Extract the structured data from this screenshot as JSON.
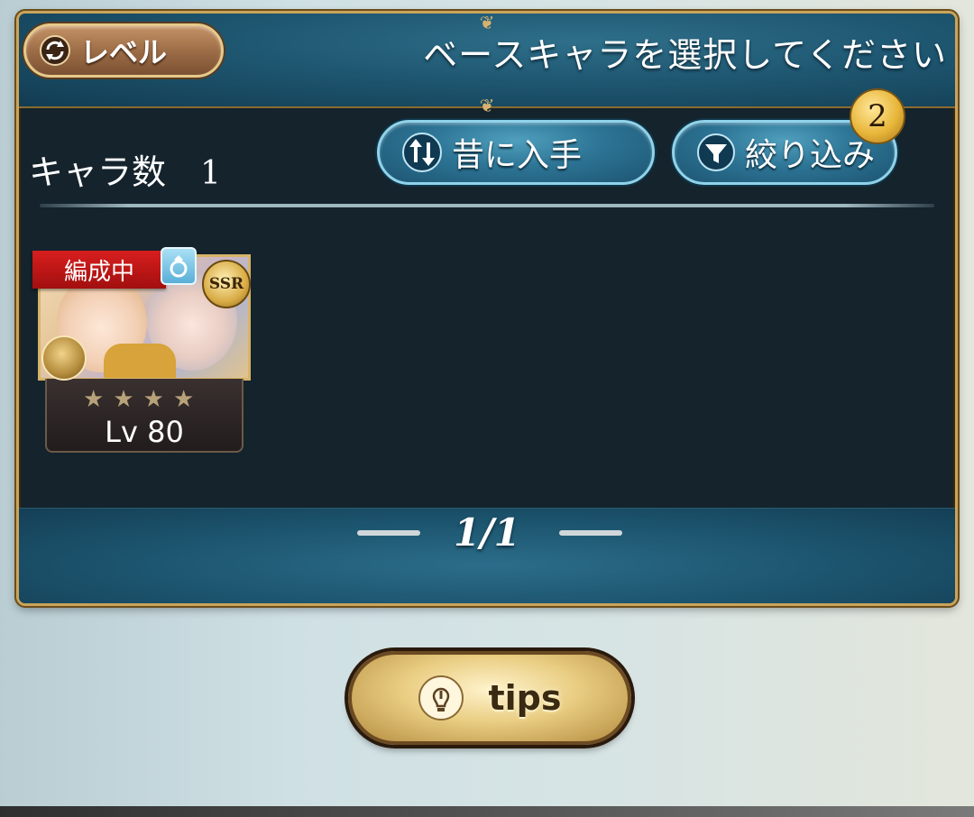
{
  "header": {
    "level_button_label": "レベル",
    "title": "ベースキャラを選択してください"
  },
  "toolbar": {
    "chara_count_label": "キャラ数",
    "chara_count_value": "1",
    "sort_label": "昔に入手",
    "filter_label": "絞り込み",
    "filter_count": "2"
  },
  "characters": [
    {
      "formation_label": "編成中",
      "rarity": "SSR",
      "stars": 4,
      "level": "Lv 80"
    }
  ],
  "pagination": {
    "text": "1/1"
  },
  "tips_button_label": "tips",
  "colors": {
    "panel_bg": "#14232c",
    "header_blue": "#1e5670",
    "gold_border": "#c9a45a",
    "formation_red": "#c71818"
  }
}
